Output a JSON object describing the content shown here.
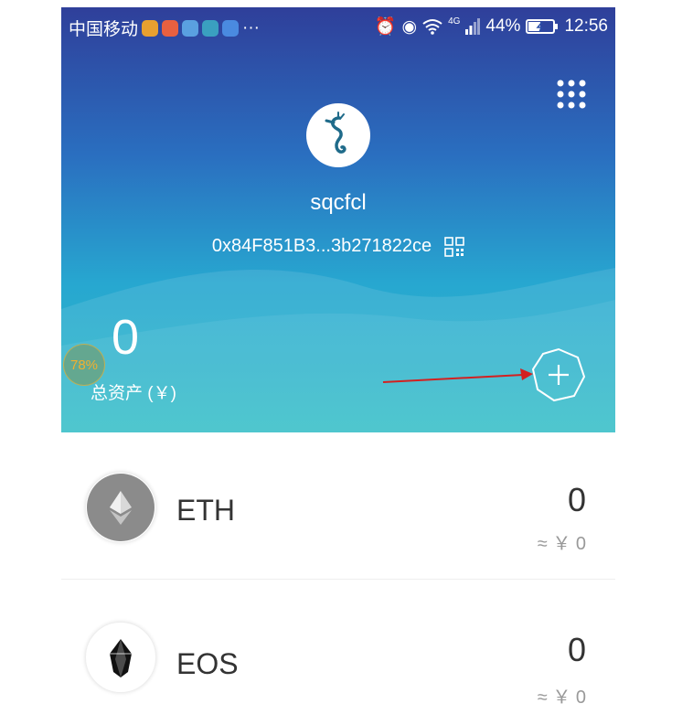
{
  "status_bar": {
    "carrier": "中国移动",
    "more": "···",
    "network": "4G",
    "battery_percent": "44%",
    "time": "12:56"
  },
  "wallet": {
    "name": "sqcfcl",
    "address": "0x84F851B3...3b271822ce"
  },
  "assets": {
    "total": "0",
    "label": "总资产 (￥)"
  },
  "overlay_badge": "78%",
  "tokens": [
    {
      "symbol": "ETH",
      "amount": "0",
      "fiat": "≈ ￥ 0"
    },
    {
      "symbol": "EOS",
      "amount": "0",
      "fiat": "≈ ￥ 0"
    }
  ],
  "colors": {
    "header_top": "#2f3f9a",
    "header_bottom": "#2dbcc6",
    "arrow": "#d32020"
  }
}
